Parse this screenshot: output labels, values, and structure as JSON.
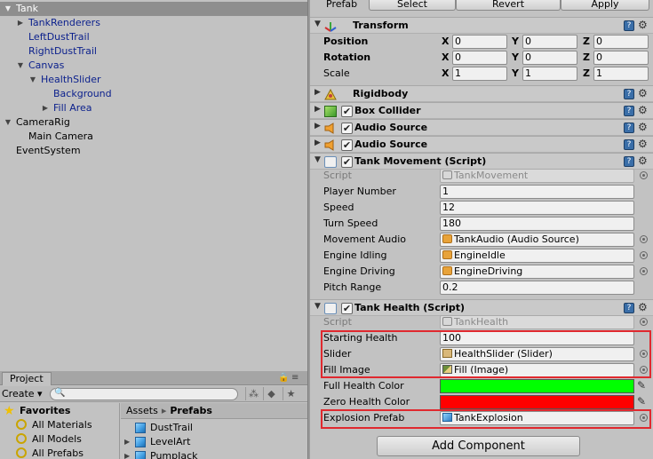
{
  "hierarchy": {
    "items": [
      {
        "label": "Tank",
        "depth": 0,
        "arrow": "▼",
        "selected": true,
        "blue": true
      },
      {
        "label": "TankRenderers",
        "depth": 1,
        "arrow": "▶",
        "blue": true
      },
      {
        "label": "LeftDustTrail",
        "depth": 1,
        "arrow": "",
        "blue": true
      },
      {
        "label": "RightDustTrail",
        "depth": 1,
        "arrow": "",
        "blue": true
      },
      {
        "label": "Canvas",
        "depth": 1,
        "arrow": "▼",
        "blue": true
      },
      {
        "label": "HealthSlider",
        "depth": 2,
        "arrow": "▼",
        "blue": true
      },
      {
        "label": "Background",
        "depth": 3,
        "arrow": "",
        "blue": true
      },
      {
        "label": "Fill Area",
        "depth": 3,
        "arrow": "▶",
        "blue": true
      },
      {
        "label": "CameraRig",
        "depth": 0,
        "arrow": "▼",
        "blue": false
      },
      {
        "label": "Main Camera",
        "depth": 1,
        "arrow": "",
        "blue": false
      },
      {
        "label": "EventSystem",
        "depth": 0,
        "arrow": "",
        "blue": false
      }
    ]
  },
  "project": {
    "tab_label": "Project",
    "create_label": "Create ▾",
    "favorites": [
      {
        "label": "Favorites",
        "icon": "star-icon",
        "bold": true
      },
      {
        "label": "All Materials",
        "icon": "search-icon"
      },
      {
        "label": "All Models",
        "icon": "search-icon"
      },
      {
        "label": "All Prefabs",
        "icon": "search-icon"
      }
    ],
    "breadcrumb": {
      "root": "Assets",
      "separator": "▸",
      "current": "Prefabs"
    },
    "assets": [
      {
        "label": "DustTrail",
        "arrow": ""
      },
      {
        "label": "LevelArt",
        "arrow": "▶"
      },
      {
        "label": "PumpJack",
        "arrow": "▶"
      }
    ]
  },
  "inspector": {
    "prefab": {
      "label": "Prefab",
      "select": "Select",
      "revert": "Revert",
      "apply": "Apply"
    },
    "transform": {
      "title": "Transform",
      "rows": [
        {
          "label": "Position",
          "x": "0",
          "y": "0",
          "z": "0",
          "bold": true
        },
        {
          "label": "Rotation",
          "x": "0",
          "y": "0",
          "z": "0",
          "bold": true
        },
        {
          "label": "Scale",
          "x": "1",
          "y": "1",
          "z": "1",
          "bold": false
        }
      ],
      "axis_labels": [
        "X",
        "Y",
        "Z"
      ]
    },
    "rigidbody": {
      "title": "Rigidbody"
    },
    "box_collider": {
      "title": "Box Collider"
    },
    "audio_source_1": {
      "title": "Audio Source"
    },
    "audio_source_2": {
      "title": "Audio Source"
    },
    "tank_movement": {
      "title": "Tank Movement (Script)",
      "script_label": "Script",
      "script_value": "TankMovement",
      "rows": [
        {
          "label": "Player Number",
          "value": "1"
        },
        {
          "label": "Speed",
          "value": "12"
        },
        {
          "label": "Turn Speed",
          "value": "180"
        },
        {
          "label": "Movement Audio",
          "value": "TankAudio (Audio Source)"
        },
        {
          "label": "Engine Idling",
          "value": "EngineIdle"
        },
        {
          "label": "Engine Driving",
          "value": "EngineDriving"
        },
        {
          "label": "Pitch Range",
          "value": "0.2"
        }
      ]
    },
    "tank_health": {
      "title": "Tank Health (Script)",
      "script_label": "Script",
      "script_value": "TankHealth",
      "starting_health_label": "Starting Health",
      "starting_health": "100",
      "slider_label": "Slider",
      "slider_value": "HealthSlider (Slider)",
      "fill_image_label": "Fill Image",
      "fill_image_value": "Fill (Image)",
      "full_color_label": "Full Health Color",
      "full_color": "#00ff00",
      "zero_color_label": "Zero Health Color",
      "zero_color": "#ff0000",
      "explosion_label": "Explosion Prefab",
      "explosion_value": "TankExplosion"
    },
    "add_component_label": "Add Component"
  },
  "colors": {
    "highlight": "#e0292f",
    "selected_row": "#8e8e8e",
    "prefab_blue": "#0a1f8c"
  }
}
